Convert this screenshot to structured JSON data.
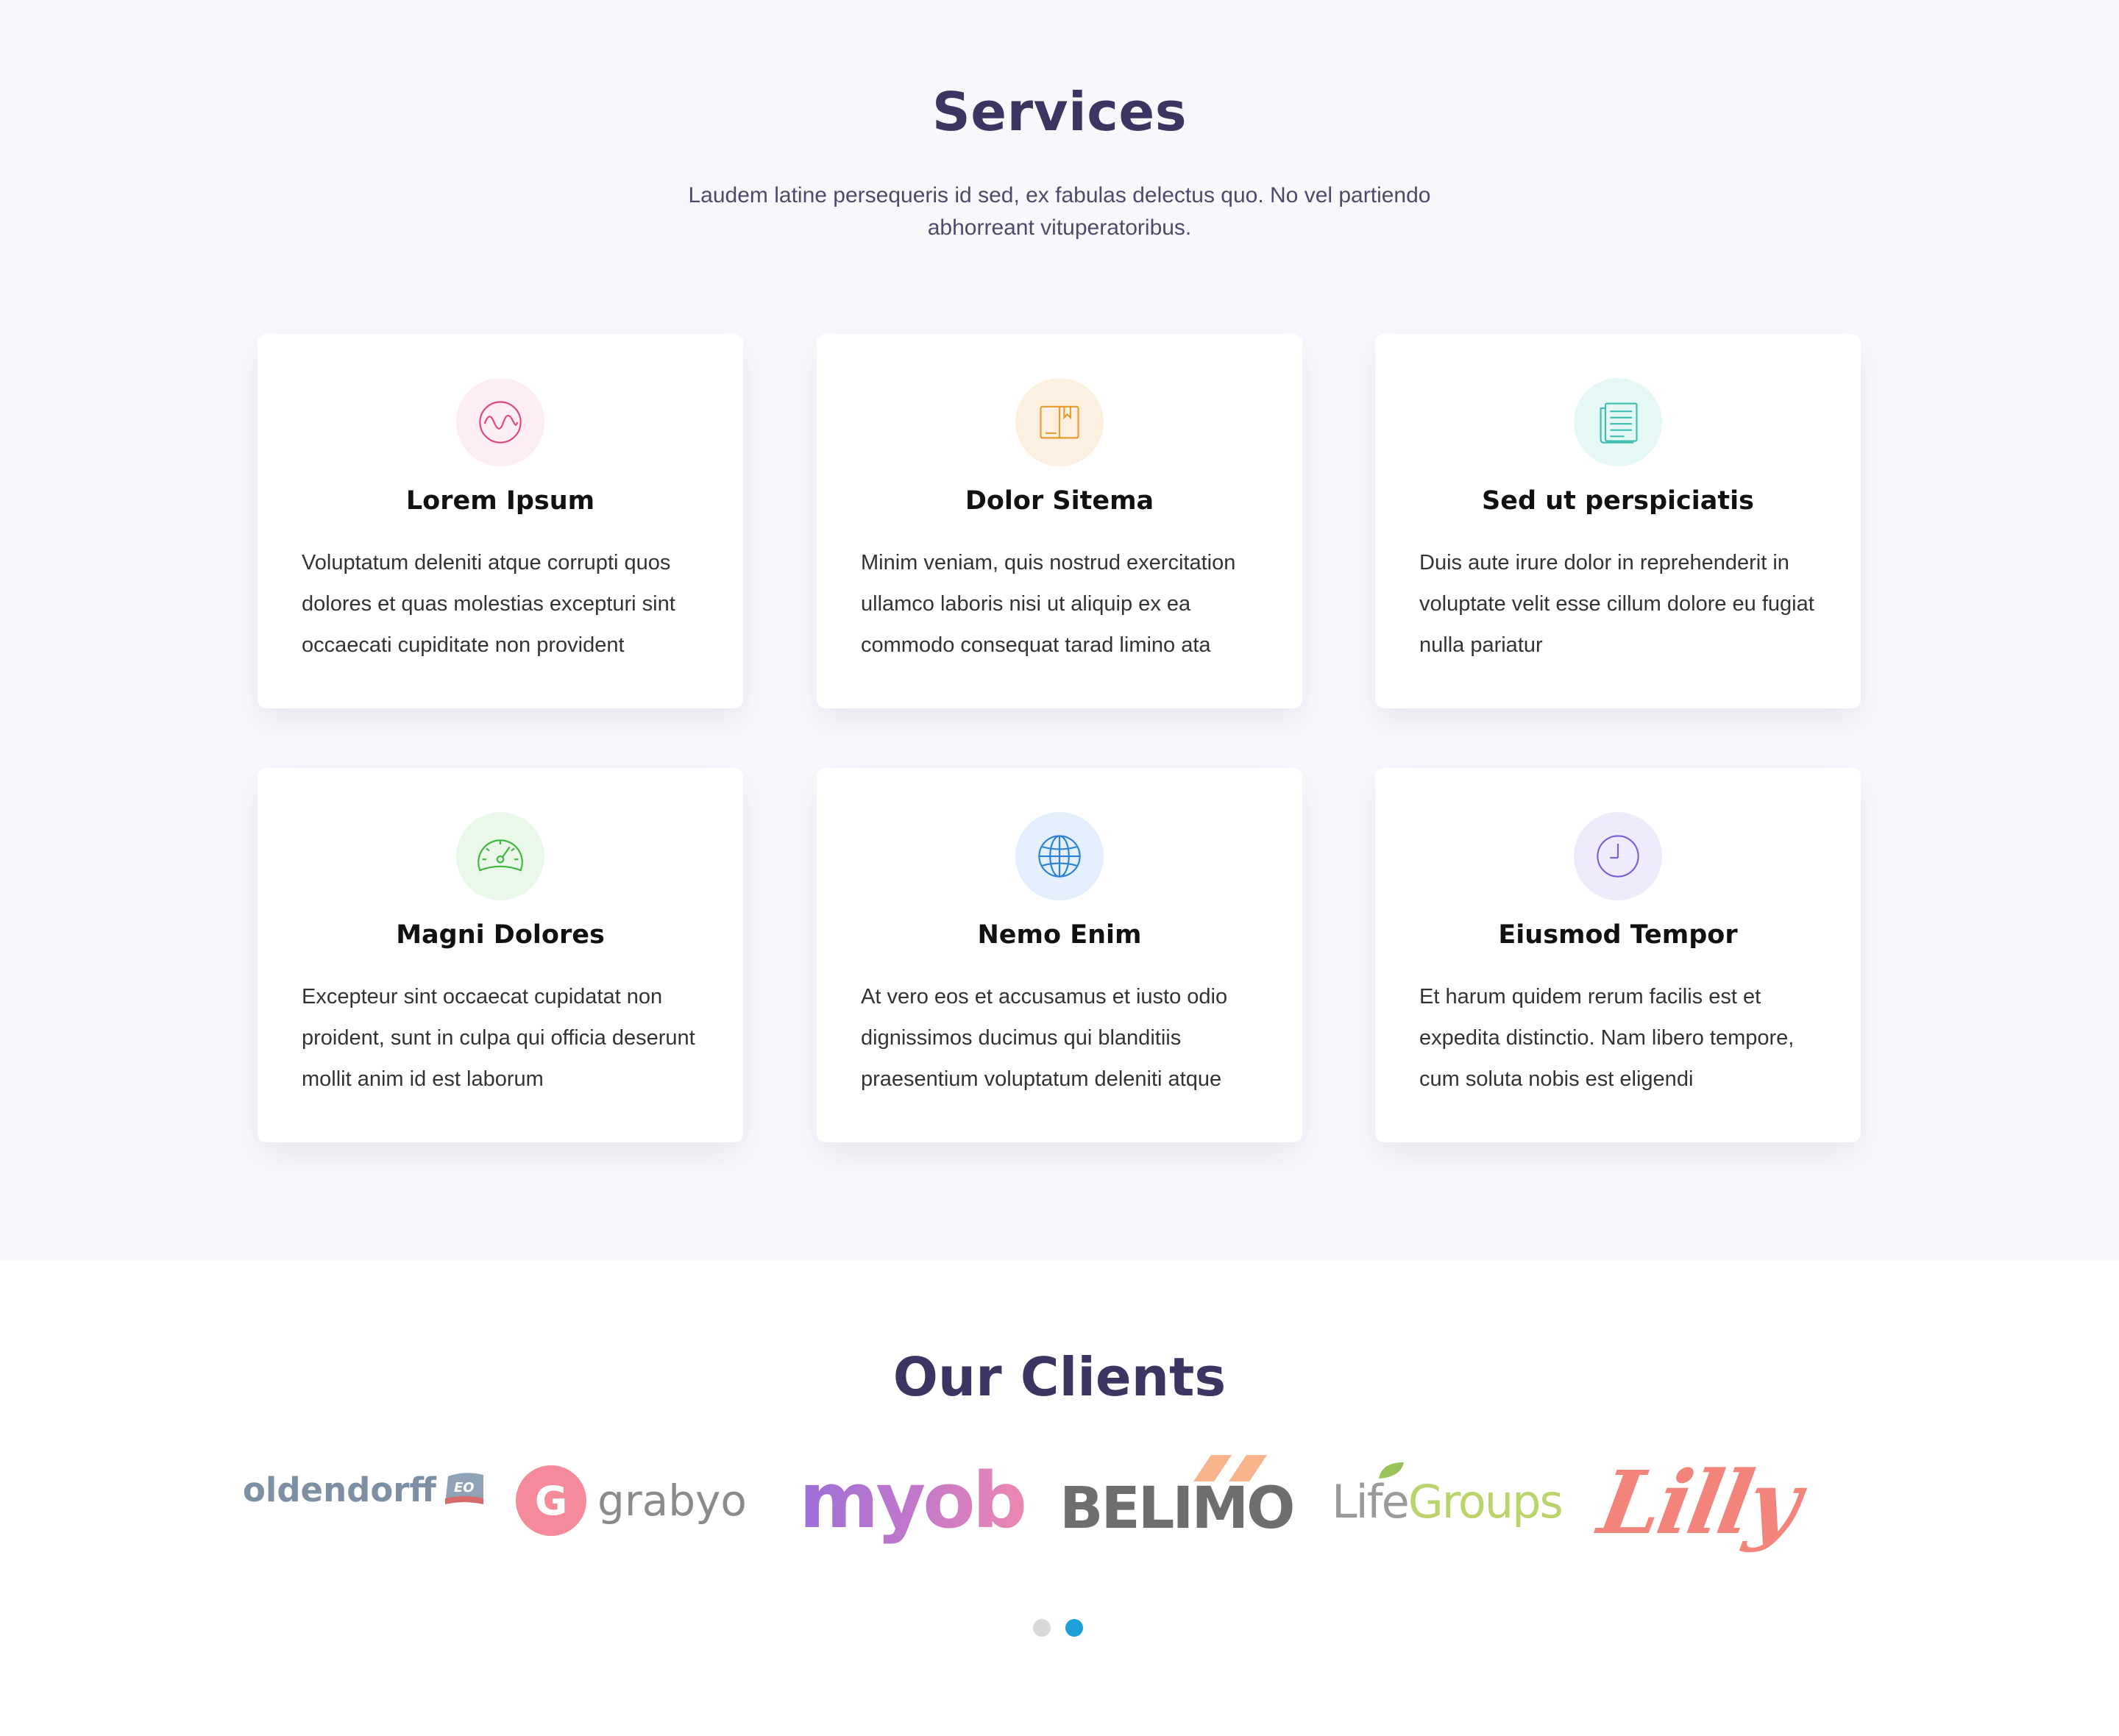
{
  "services": {
    "title": "Services",
    "subtitle": "Laudem latine persequeris id sed, ex fabulas delectus quo. No vel partiendo abhorreant vituperatoribus.",
    "cards": [
      {
        "title": "Lorem Ipsum",
        "text": "Voluptatum deleniti atque corrupti quos dolores et quas molestias excepturi sint occaecati cupiditate non provident",
        "icon": "wave-icon",
        "icon_color": "#e0457b",
        "icon_bg": "#fdeef3"
      },
      {
        "title": "Dolor Sitema",
        "text": "Minim veniam, quis nostrud exercitation ullamco laboris nisi ut aliquip ex ea commodo consequat tarad limino ata",
        "icon": "book-icon",
        "icon_color": "#e89a2c",
        "icon_bg": "#fdf0e1"
      },
      {
        "title": "Sed ut perspiciatis",
        "text": "Duis aute irure dolor in reprehenderit in voluptate velit esse cillum dolore eu fugiat nulla pariatur",
        "icon": "document-icon",
        "icon_color": "#3dbdb0",
        "icon_bg": "#e6f8f6"
      },
      {
        "title": "Magni Dolores",
        "text": "Excepteur sint occaecat cupidatat non proident, sunt in culpa qui officia deserunt mollit anim id est laborum",
        "icon": "speedometer-icon",
        "icon_color": "#3eb53e",
        "icon_bg": "#eaf8ea"
      },
      {
        "title": "Nemo Enim",
        "text": "At vero eos et accusamus et iusto odio dignissimos ducimus qui blanditiis praesentium voluptatum deleniti atque",
        "icon": "globe-icon",
        "icon_color": "#2a7fd8",
        "icon_bg": "#e3effc"
      },
      {
        "title": "Eiusmod Tempor",
        "text": "Et harum quidem rerum facilis est et expedita distinctio. Nam libero tempore, cum soluta nobis est eligendi",
        "icon": "clock-icon",
        "icon_color": "#7a5ed8",
        "icon_bg": "#efebfc"
      }
    ]
  },
  "clients": {
    "title": "Our Clients",
    "logos": [
      {
        "name": "oldendorff",
        "badge": "EO",
        "color": "#7d8fa3"
      },
      {
        "name": "grabyo",
        "mark": "G",
        "color": "#f48a9a"
      },
      {
        "name": "myob",
        "color": "#b777d6"
      },
      {
        "name": "BELIMO",
        "color": "#6e6e6e",
        "accent": "#f7b48a"
      },
      {
        "life": "Life",
        "groups": "Groups",
        "color": "#9a9a9a",
        "accent": "#b8d46a"
      },
      {
        "name": "Lilly",
        "color": "#f3847c"
      }
    ],
    "pager": {
      "count": 2,
      "active_index": 1,
      "active_color": "#1ea0d8"
    }
  }
}
